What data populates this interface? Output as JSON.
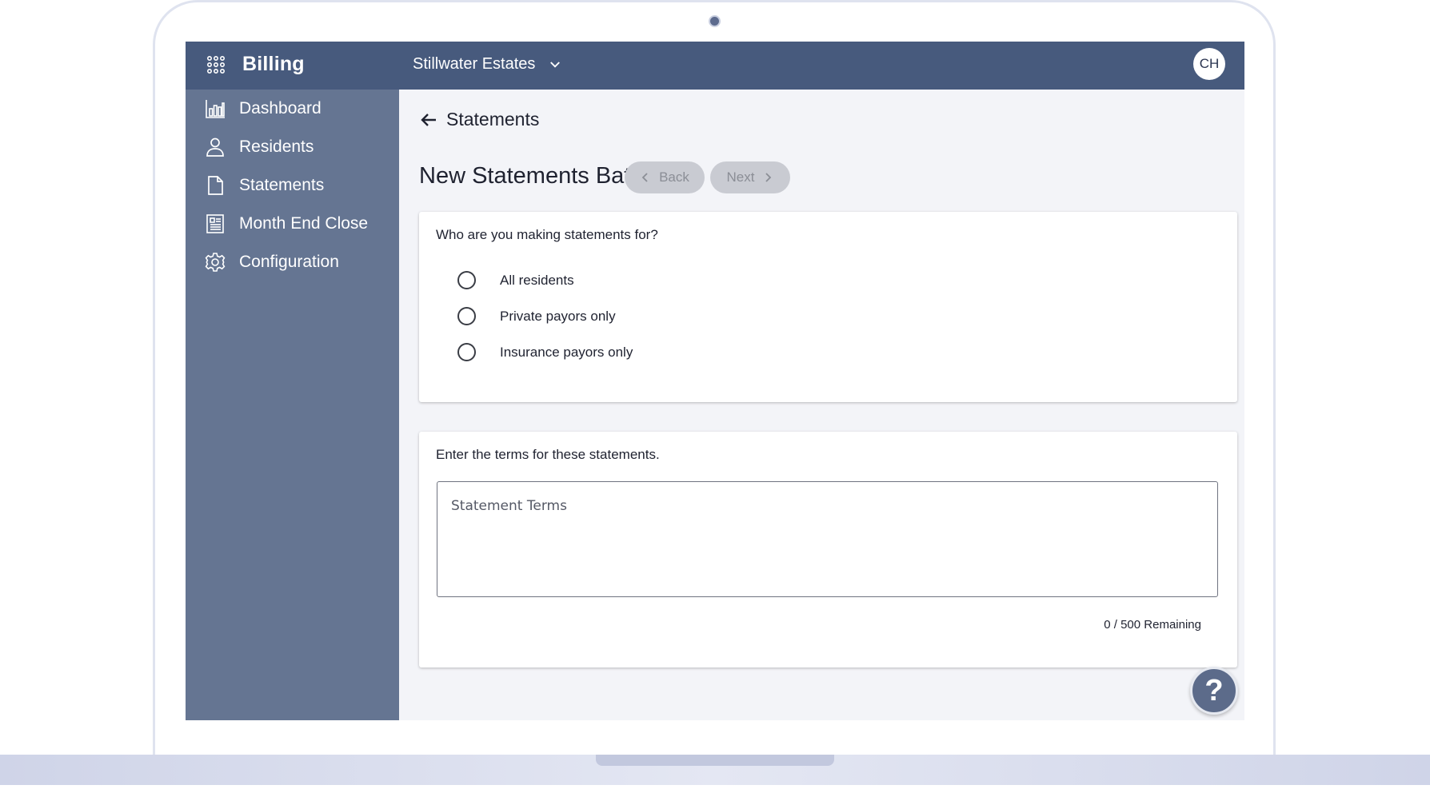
{
  "app": {
    "title": "Billing",
    "facility": "Stillwater Estates",
    "user_initials": "CH"
  },
  "sidebar": {
    "items": [
      {
        "label": "Dashboard",
        "icon": "bar-chart-icon"
      },
      {
        "label": "Residents",
        "icon": "person-icon"
      },
      {
        "label": "Statements",
        "icon": "document-icon"
      },
      {
        "label": "Month End Close",
        "icon": "ledger-icon"
      },
      {
        "label": "Configuration",
        "icon": "gear-icon"
      }
    ]
  },
  "main": {
    "back_label": "Statements",
    "page_title": "New Statements Batch",
    "back_button": "Back",
    "next_button": "Next",
    "who_card": {
      "question": "Who are you making statements for?",
      "options": [
        "All residents",
        "Private payors only",
        "Insurance payors only"
      ]
    },
    "terms_card": {
      "prompt": "Enter the terms for these statements.",
      "placeholder": "Statement Terms",
      "value": "",
      "counter": "0 / 500 Remaining"
    },
    "help_label": "?"
  },
  "colors": {
    "topbar": "#475a7d",
    "sidebar": "#657592",
    "content_bg": "#f3f4f8",
    "button_disabled": "#c9cbd2"
  }
}
